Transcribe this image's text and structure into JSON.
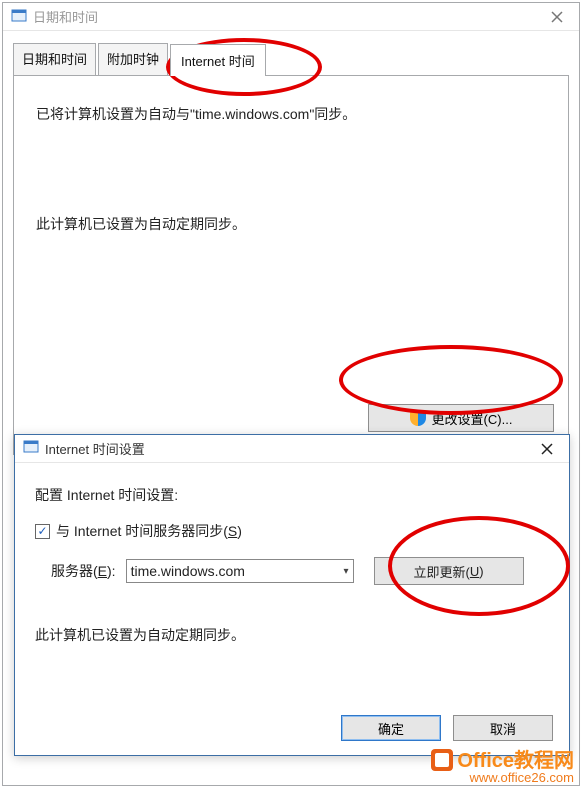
{
  "outer": {
    "title": "日期和时间",
    "tabs": [
      "日期和时间",
      "附加时钟",
      "Internet 时间"
    ],
    "active_tab_index": 2,
    "sync_info": "已将计算机设置为自动与\"time.windows.com\"同步。",
    "auto_sync": "此计算机已设置为自动定期同步。",
    "change_settings_label": "更改设置(C)..."
  },
  "inner": {
    "title": "Internet 时间设置",
    "configure_label": "配置 Internet 时间设置:",
    "sync_checkbox_label_prefix": "与 Internet 时间服务器同步(",
    "sync_checkbox_accel": "S",
    "sync_checkbox_label_suffix": ")",
    "sync_checked": true,
    "server_label_prefix": "服务器(",
    "server_accel": "E",
    "server_label_suffix": "):",
    "server_value": "time.windows.com",
    "update_now_prefix": "立即更新(",
    "update_now_accel": "U",
    "update_now_suffix": ")",
    "status": "此计算机已设置为自动定期同步。",
    "ok_label": "确定",
    "cancel_label": "取消"
  },
  "watermark": {
    "brand": "Office教程网",
    "url": "www.office26.com"
  }
}
